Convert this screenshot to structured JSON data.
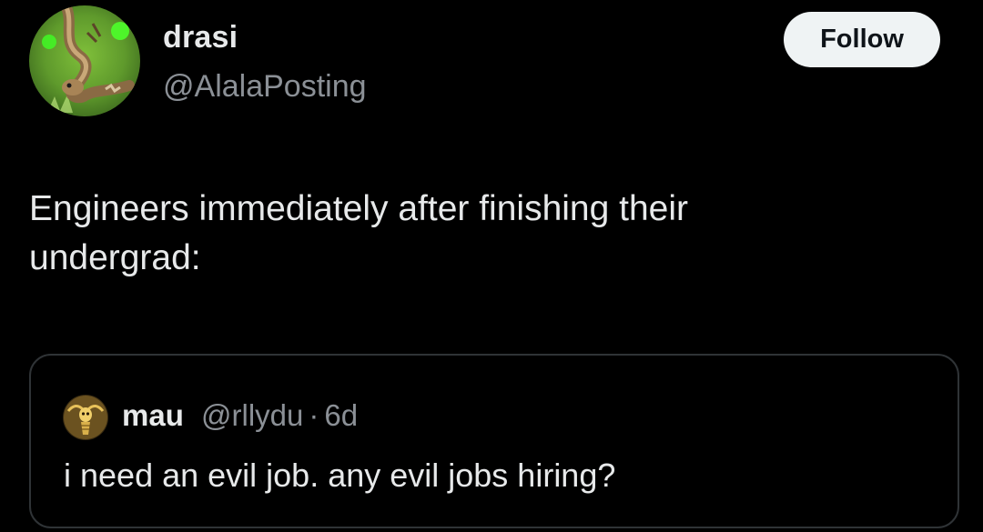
{
  "tweet": {
    "author": {
      "display_name": "drasi",
      "handle": "@AlalaPosting",
      "avatar_icon": "lizard-avatar"
    },
    "follow_label": "Follow",
    "text": "Engineers immediately after finishing their\nundergrad:",
    "quoted": {
      "name": "mau",
      "handle": "@rllydu",
      "separator": "·",
      "time": "6d",
      "avatar_icon": "golden-skeleton-avatar",
      "text": "i need an evil job. any evil jobs hiring?"
    }
  },
  "colors": {
    "background": "#000000",
    "primary_text": "#e7e9ea",
    "secondary_text": "#8b9096",
    "follow_button_bg": "#eff3f4",
    "follow_button_text": "#0f1419",
    "card_border": "#2f3336"
  }
}
